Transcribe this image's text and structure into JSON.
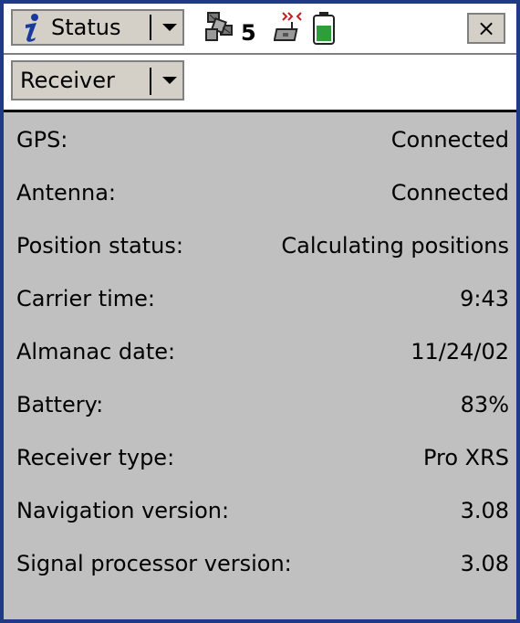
{
  "header": {
    "title": "Status",
    "satellite_count": "5",
    "close_label": "×"
  },
  "selector": {
    "value": "Receiver"
  },
  "rows": [
    {
      "label": "GPS:",
      "value": "Connected"
    },
    {
      "label": "Antenna:",
      "value": "Connected"
    },
    {
      "label": "Position status:",
      "value": "Calculating positions"
    },
    {
      "label": "Carrier time:",
      "value": "9:43"
    },
    {
      "label": "Almanac date:",
      "value": "11/24/02"
    },
    {
      "label": "Battery:",
      "value": "83%"
    },
    {
      "label": "Receiver type:",
      "value": "Pro XRS"
    },
    {
      "label": "Navigation version:",
      "value": "3.08"
    },
    {
      "label": "Signal processor version:",
      "value": "3.08"
    }
  ],
  "colors": {
    "frame": "#1f3a86",
    "panel": "#c0c0c0",
    "battery_fill": "#2e9e3a",
    "info_icon": "#1a3a9a"
  },
  "icons": {
    "info": "info-icon",
    "satellite": "satellite-icon",
    "radio": "radio-signal-icon",
    "battery": "battery-icon",
    "close": "close-icon"
  }
}
